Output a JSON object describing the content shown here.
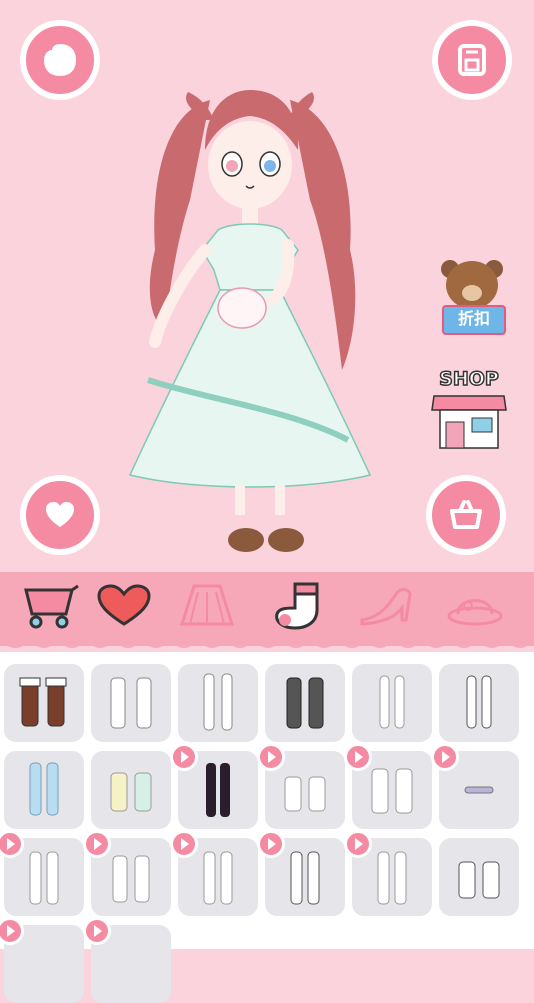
{
  "top_bar": {
    "left_icon": "cookie-icon",
    "right_icon": "save-icon"
  },
  "side_badges": {
    "sale_label": "折扣",
    "shop_label": "SHOP"
  },
  "bottom_controls": {
    "left_icon": "heart-icon",
    "right_icon": "basket-icon"
  },
  "tabs": [
    {
      "name": "cart",
      "icon": "cart-icon"
    },
    {
      "name": "heart",
      "icon": "heart-icon"
    },
    {
      "name": "skirt",
      "icon": "skirt-icon"
    },
    {
      "name": "socks",
      "icon": "sock-icon",
      "selected": true
    },
    {
      "name": "shoes",
      "icon": "high-heel-icon"
    },
    {
      "name": "hats",
      "icon": "hat-icon"
    }
  ],
  "items": [
    {
      "id": "brown-ruffle-socks",
      "locked": false,
      "color": "#7a3f2a"
    },
    {
      "id": "white-lace-socks",
      "locked": false,
      "color": "#ffffff"
    },
    {
      "id": "white-thigh-highs",
      "locked": false,
      "color": "#ffffff"
    },
    {
      "id": "black-fishnet-socks",
      "locked": false,
      "color": "#3a3a3a"
    },
    {
      "id": "white-ribbon-stockings",
      "locked": false,
      "color": "#ffffff"
    },
    {
      "id": "white-bow-stockings",
      "locked": false,
      "color": "#ffffff"
    },
    {
      "id": "blue-stockings",
      "locked": false,
      "color": "#b8dcf2"
    },
    {
      "id": "rainbow-socks",
      "locked": false,
      "color": "#f7f2c6"
    },
    {
      "id": "black-bow-stockings",
      "locked": true,
      "color": "#2a1e2c"
    },
    {
      "id": "pink-trim-ankle-socks",
      "locked": true,
      "color": "#ffffff"
    },
    {
      "id": "slouch-socks",
      "locked": true,
      "color": "#ffffff"
    },
    {
      "id": "bead-anklet",
      "locked": true,
      "color": "#b9b4d8"
    },
    {
      "id": "pink-trim-knee-socks",
      "locked": true,
      "color": "#ffffff"
    },
    {
      "id": "pink-lace-socks",
      "locked": true,
      "color": "#ffffff"
    },
    {
      "id": "white-knee-socks",
      "locked": true,
      "color": "#ffffff"
    },
    {
      "id": "black-bow-knee-socks",
      "locked": true,
      "color": "#ffffff"
    },
    {
      "id": "heart-knee-socks",
      "locked": true,
      "color": "#ffffff"
    },
    {
      "id": "blue-trim-ankle-socks",
      "locked": false,
      "color": "#ffffff"
    },
    {
      "id": "partial-item-1",
      "locked": true,
      "color": "#ffffff"
    },
    {
      "id": "partial-item-2",
      "locked": true,
      "color": "#ffffff"
    }
  ],
  "colors": {
    "background": "#fbd3dc",
    "accent": "#f58aa3",
    "tabbar": "#f7a8b8"
  }
}
